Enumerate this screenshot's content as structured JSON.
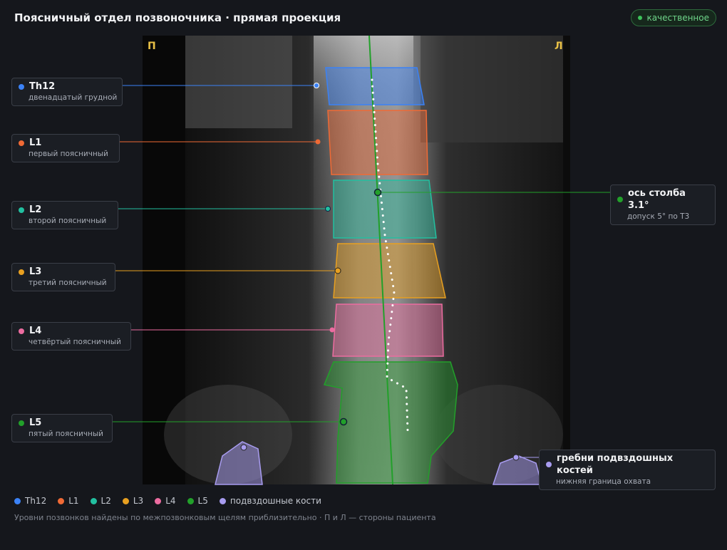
{
  "title": "Поясничный отдел позвоночника · прямая проекция",
  "badge": "качественное",
  "side_right": "П",
  "side_left": "Л",
  "vertebrae": [
    {
      "name": "Th12",
      "desc": "двенадцатый грудной",
      "color": "#3b82f6"
    },
    {
      "name": "L1",
      "desc": "первый поясничный",
      "color": "#f06a35"
    },
    {
      "name": "L2",
      "desc": "второй поясничный",
      "color": "#22c0a0"
    },
    {
      "name": "L3",
      "desc": "третий поясничный",
      "color": "#e8a020"
    },
    {
      "name": "L4",
      "desc": "четвёртый поясничный",
      "color": "#ec6ca0"
    },
    {
      "name": "L5",
      "desc": "пятый поясничный",
      "color": "#22a02a"
    }
  ],
  "axis": {
    "title": "ось столба 3.1°",
    "desc": "допуск 5° по Т3",
    "color": "#22a02a"
  },
  "iliac": {
    "title": "гребни подвздошных костей",
    "desc": "нижняя граница охвата",
    "color": "#a89cf0"
  },
  "legend": [
    {
      "label": "Th12",
      "color": "#3b82f6"
    },
    {
      "label": "L1",
      "color": "#f06a35"
    },
    {
      "label": "L2",
      "color": "#22c0a0"
    },
    {
      "label": "L3",
      "color": "#e8a020"
    },
    {
      "label": "L4",
      "color": "#ec6ca0"
    },
    {
      "label": "L5",
      "color": "#22a02a"
    },
    {
      "label": "подвздошные кости",
      "color": "#a89cf0"
    }
  ],
  "footnote": "Уровни позвонков найдены по межпозвонковым щелям приблизительно · П и Л — стороны пациента"
}
